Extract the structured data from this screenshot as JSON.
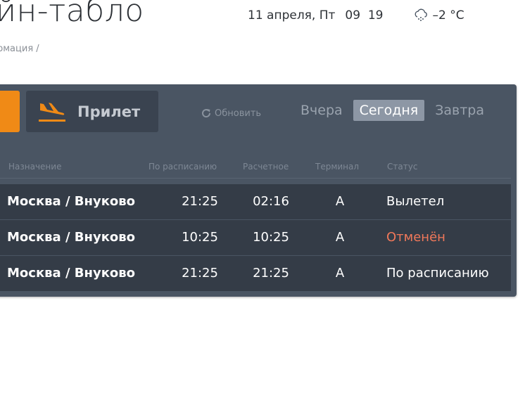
{
  "header": {
    "title": "йн-табло",
    "date": "11 апреля, Пт",
    "time_h": "09",
    "time_m": "19",
    "temperature": "–2 °C",
    "weather_icon": "snow-cloud-icon",
    "breadcrumb": "рмация /"
  },
  "board": {
    "arrive_tab_label": "Прилет",
    "refresh_label": "Обновить",
    "day_tabs": [
      "Вчера",
      "Сегодня",
      "Завтра"
    ],
    "active_day": "Сегодня",
    "columns": [
      "Назначение",
      "По расписанию",
      "Расчетное",
      "Терминал",
      "Статус"
    ],
    "rows": [
      {
        "destination": "Москва / Внуково",
        "scheduled": "21:25",
        "estimated": "02:16",
        "terminal": "A",
        "status": "Вылетел"
      },
      {
        "destination": "Москва / Внуково",
        "scheduled": "10:25",
        "estimated": "10:25",
        "terminal": "A",
        "status": "Отменён"
      },
      {
        "destination": "Москва / Внуково",
        "scheduled": "21:25",
        "estimated": "21:25",
        "terminal": "A",
        "status": "По расписанию"
      }
    ]
  },
  "colors": {
    "accent_orange": "#f08a16",
    "board_bg": "#4a5563",
    "row_bg": "#343c47",
    "cancelled": "#f0785a"
  }
}
